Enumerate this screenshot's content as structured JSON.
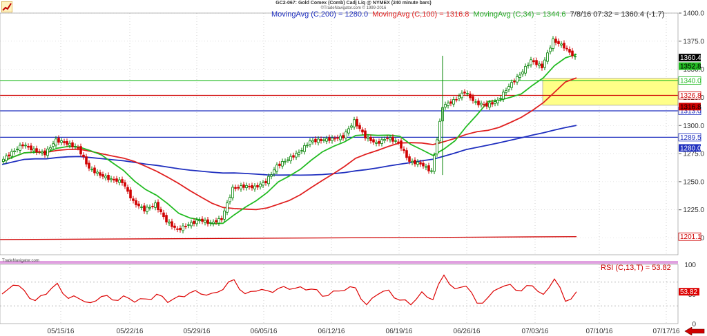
{
  "header": {
    "title": "GC2-067:  Gold Comex (Comb) Cadj Liq @ NYMEX  (240 minute bars)",
    "subtitle": "©TradeNavigator.com © 1999-2016"
  },
  "indicators_line": {
    "ma200": "MovingAvg (C,200) = 1280.0",
    "ma100": "MovingAvg (C,100) = 1316.8",
    "ma34": "MovingAvg (C,34) = 1344.6",
    "last": "7/8/16 07:32 = 1360.4 (-1.7)"
  },
  "watermark": "TradeNavigator.com",
  "rsi_label": "RSI (C,13,T) = 53.82",
  "colors": {
    "up": "#008000",
    "down": "#d00000",
    "ma200": "#1f2fbf",
    "ma100": "#e02020",
    "ma34": "#22bb22",
    "rsi": "#dd0000",
    "zone": "#ffff88"
  },
  "chart_data": [
    {
      "type": "line",
      "name": "price",
      "ylim": [
        1185,
        1400
      ],
      "yticks": [
        "1400.0",
        "1375.0",
        "1350.0",
        "1325.0",
        "1300.0",
        "1275.0",
        "1250.0",
        "1225.0",
        "1200.0"
      ],
      "xticks": [
        "05/15/16",
        "05/22/16",
        "05/29/16",
        "06/05/16",
        "06/12/16",
        "06/19/16",
        "06/26/16",
        "07/03/16",
        "07/10/16",
        "07/17/16"
      ],
      "close_series": [
        {
          "x": "05/10/16",
          "close": 1268
        },
        {
          "x": "05/11/16",
          "close": 1276
        },
        {
          "x": "05/12/16",
          "close": 1283
        },
        {
          "x": "05/13/16",
          "close": 1278
        },
        {
          "x": "05/14/16",
          "close": 1275
        },
        {
          "x": "05/16/16",
          "close": 1287
        },
        {
          "x": "05/17/16",
          "close": 1284
        },
        {
          "x": "05/18/16",
          "close": 1280
        },
        {
          "x": "05/19/16",
          "close": 1262
        },
        {
          "x": "05/20/16",
          "close": 1256
        },
        {
          "x": "05/22/16",
          "close": 1252
        },
        {
          "x": "05/23/16",
          "close": 1250
        },
        {
          "x": "05/24/16",
          "close": 1232
        },
        {
          "x": "05/25/16",
          "close": 1225
        },
        {
          "x": "05/26/16",
          "close": 1230
        },
        {
          "x": "05/27/16",
          "close": 1215
        },
        {
          "x": "05/29/16",
          "close": 1207
        },
        {
          "x": "05/30/16",
          "close": 1212
        },
        {
          "x": "05/31/16",
          "close": 1216
        },
        {
          "x": "06/01/16",
          "close": 1213
        },
        {
          "x": "06/02/16",
          "close": 1217
        },
        {
          "x": "06/03/16",
          "close": 1244
        },
        {
          "x": "06/05/16",
          "close": 1246
        },
        {
          "x": "06/06/16",
          "close": 1245
        },
        {
          "x": "06/07/16",
          "close": 1250
        },
        {
          "x": "06/08/16",
          "close": 1264
        },
        {
          "x": "06/09/16",
          "close": 1270
        },
        {
          "x": "06/10/16",
          "close": 1276
        },
        {
          "x": "06/12/16",
          "close": 1286
        },
        {
          "x": "06/13/16",
          "close": 1287
        },
        {
          "x": "06/14/16",
          "close": 1288
        },
        {
          "x": "06/15/16",
          "close": 1290
        },
        {
          "x": "06/16/16",
          "close": 1304
        },
        {
          "x": "06/17/16",
          "close": 1290
        },
        {
          "x": "06/19/16",
          "close": 1284
        },
        {
          "x": "06/20/16",
          "close": 1289
        },
        {
          "x": "06/21/16",
          "close": 1285
        },
        {
          "x": "06/22/16",
          "close": 1268
        },
        {
          "x": "06/23/16",
          "close": 1266
        },
        {
          "x": "06/24/16",
          "close": 1259
        },
        {
          "x": "06/24/16 b",
          "close": 1317
        },
        {
          "x": "06/26/16",
          "close": 1322
        },
        {
          "x": "06/27/16",
          "close": 1330
        },
        {
          "x": "06/28/16",
          "close": 1320
        },
        {
          "x": "06/29/16",
          "close": 1318
        },
        {
          "x": "06/30/16",
          "close": 1322
        },
        {
          "x": "07/01/16",
          "close": 1335
        },
        {
          "x": "07/03/16",
          "close": 1345
        },
        {
          "x": "07/04/16",
          "close": 1358
        },
        {
          "x": "07/05/16",
          "close": 1352
        },
        {
          "x": "07/06/16",
          "close": 1376
        },
        {
          "x": "07/07/16",
          "close": 1370
        },
        {
          "x": "07/08/16",
          "close": 1360.4
        }
      ],
      "moving_averages": [
        {
          "name": "MovingAvg (C,200)",
          "last": 1280.0
        },
        {
          "name": "MovingAvg (C,100)",
          "last": 1316.8
        },
        {
          "name": "MovingAvg (C,34)",
          "last": 1344.6
        }
      ],
      "horizontal_lines": [
        {
          "label": "1340.0",
          "value": 1340.0,
          "color": "#22bb22"
        },
        {
          "label": "1326.8",
          "value": 1326.8,
          "color": "#d00000"
        },
        {
          "label": "1313.0",
          "value": 1313.0,
          "color": "#1f2fbf"
        },
        {
          "label": "1289.5",
          "value": 1289.5,
          "color": "#1f2fbf"
        },
        {
          "label": "1201.1",
          "value": 1201.1,
          "color": "#d00000"
        }
      ],
      "price_labels": [
        {
          "label": "1360.4",
          "value": 1360.4,
          "bg": "#000000",
          "fg": "#ffffff"
        },
        {
          "label": "1352.8",
          "value": 1352.8,
          "bg": "#22bb22",
          "fg": "#000000"
        },
        {
          "label": "1316.8",
          "value": 1316.8,
          "bg": "#d00000",
          "fg": "#000000"
        },
        {
          "label": "1280.0",
          "value": 1280.0,
          "bg": "#1f2fbf",
          "fg": "#ffffff"
        }
      ],
      "zone": {
        "low": 1318,
        "high": 1342,
        "from": "07/04/16",
        "to": "07/17/16"
      }
    },
    {
      "type": "line",
      "name": "RSI (C,13,T)",
      "ylim": [
        0,
        100
      ],
      "yticks": [
        "100",
        "50",
        "0"
      ],
      "last": 53.82,
      "last_label": "53.82"
    }
  ]
}
